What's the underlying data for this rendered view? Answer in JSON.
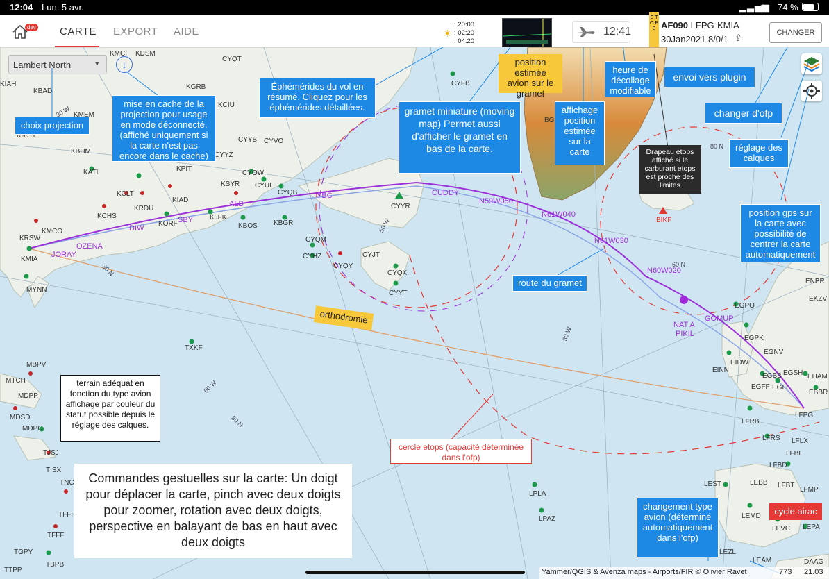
{
  "statusbar": {
    "time": "12:04",
    "date": "Lun. 5 avr.",
    "battery": "74 %"
  },
  "header": {
    "dev_badge": "dev",
    "tabs": [
      {
        "label": "CARTE"
      },
      {
        "label": "EXPORT"
      },
      {
        "label": "AIDE"
      }
    ],
    "ephemerides": [
      "20:00",
      "02:20",
      "04:20"
    ],
    "takeoff_time": "12:41",
    "etops_flag": "E T O P S",
    "flight_number": "AF090",
    "route": "LFPG-KMIA",
    "flight_date": "30Jan2021 8/0/1",
    "change_button": "CHANGER"
  },
  "projection_select": {
    "value": "Lambert North"
  },
  "annotations": {
    "projection": "choix projection",
    "cache": "mise en cache de la projection pour usage en mode déconnecté. (affiché uniquement si la carte n'est pas encore dans le cache)",
    "ephem": "Éphémérides du vol en résumé. Cliquez pour les éphémérides détaillées.",
    "gramet_mini": "gramet miniature (moving map) Permet aussi d'afficher le gramet en bas de la carte.",
    "estimated_gramet": "position estimée avion sur le gramet",
    "estimated_map": "affichage position estimée sur la carte",
    "takeoff_time": "heure de décollage modifiable",
    "plugin": "envoi vers plugin",
    "change_ofp": "changer d'ofp",
    "layers": "réglage des calques",
    "etops_flag": "Drapeau etops affiché si le carburant etops est proche des limites",
    "gps": "position gps sur la carte avec possibilité de centrer la carte automatiquement",
    "gramet_route": "route du gramet",
    "orthodromie": "orthodromie",
    "terrain": "terrain adéquat en fonction du type avion affichage par couleur du statut possible depuis le réglage des calques.",
    "etops_circle": "cercle etops (capacité déterminée dans l'ofp)",
    "gestures": "Commandes gestuelles sur la carte: Un doigt pour déplacer la carte, pinch avec deux doigts pour zoomer, rotation avec deux doigts, perspective en balayant de bas en haut avec deux doigts",
    "aircraft_type": "changement type avion (déterminé automatiquement dans l'ofp)",
    "airac": "cycle airac"
  },
  "attribution": {
    "text": "Yammer/QGIS & Avenza maps - Airports/FIR © Olivier Ravet",
    "code": "773",
    "version": "21.03"
  },
  "waypoints": [
    "JORAY",
    "OZENA",
    "DIW",
    "SBY",
    "ALB",
    "YBC",
    "CUDDY",
    "N59W050",
    "N61W040",
    "N61W030",
    "N60W020",
    "GOMUP",
    "NAT A",
    "PIKIL"
  ],
  "airports": [
    "KMCI",
    "KDSM",
    "CYQT",
    "KIAH",
    "KBAD",
    "KGRB",
    "KMEM",
    "KCIU",
    "KMSY",
    "CYYB",
    "CYVO",
    "KBHM",
    "KPIT",
    "CYYZ",
    "KATL",
    "CYOW",
    "CYUL",
    "CYQB",
    "KCLT",
    "KSYR",
    "KRDU",
    "KIAD",
    "KCHS",
    "KJFK",
    "KBOS",
    "KBGR",
    "KMCO",
    "KORF",
    "CYFB",
    "KRSW",
    "KMIA",
    "MYNN",
    "CYQM",
    "CYHZ",
    "CYQY",
    "CYJT",
    "CYQX",
    "CYYT",
    "CYYR",
    "BGS",
    "BIKF",
    "ENBR",
    "EKZV",
    "EGPO",
    "EGPK",
    "EGNV",
    "EIDW",
    "EINN",
    "EGBB",
    "EGFF",
    "EGLL",
    "EGSH",
    "EHAM",
    "EBBR",
    "LFPG",
    "LFRB",
    "LFRS",
    "LFLX",
    "LFBL",
    "LFBD",
    "LFBT",
    "LFMP",
    "LEST",
    "LEBB",
    "LEMD",
    "LEVC",
    "LEPA",
    "LEZL",
    "LEAM",
    "DAAG",
    "MBPV",
    "MTCH",
    "MDPP",
    "MDSD",
    "MDPC",
    "TJSJ",
    "TISX",
    "TNCM",
    "TFFR",
    "TFFF",
    "TGPY",
    "TTPP",
    "TBPB",
    "TXKF",
    "LPLA",
    "LPAZ"
  ],
  "grid_labels": [
    "30 W",
    "50 W",
    "60 N",
    "80 N",
    "60 W",
    "30 N",
    "30 W",
    "30 N"
  ]
}
